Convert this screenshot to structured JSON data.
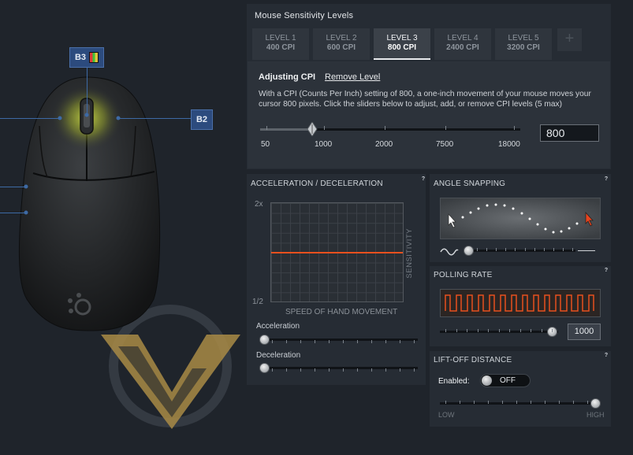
{
  "cpi": {
    "title": "Mouse Sensitivity Levels",
    "levels": [
      {
        "name": "LEVEL 1",
        "cpi": "400 CPI"
      },
      {
        "name": "LEVEL 2",
        "cpi": "600 CPI"
      },
      {
        "name": "LEVEL 3",
        "cpi": "800 CPI"
      },
      {
        "name": "LEVEL 4",
        "cpi": "2400 CPI"
      },
      {
        "name": "LEVEL 5",
        "cpi": "3200 CPI"
      }
    ],
    "active_level": 3,
    "add_label": "+",
    "adjusting_label": "Adjusting CPI",
    "remove_label": "Remove Level",
    "description": "With a CPI (Counts Per Inch) setting of 800, a one-inch movement of your mouse moves your cursor 800 pixels. Click the sliders below to adjust, add, or remove CPI levels (5 max)",
    "scale": [
      "50",
      "1000",
      "2000",
      "7500",
      "18000"
    ],
    "value": "800"
  },
  "accel": {
    "title": "ACCELERATION / DECELERATION",
    "help": "?",
    "y_top": "2x",
    "y_bottom": "1/2",
    "side_label": "SENSITIVITY",
    "x_label": "SPEED OF HAND MOVEMENT",
    "accel_label": "Acceleration",
    "decel_label": "Deceleration",
    "curve_color": "#e8501e"
  },
  "angle": {
    "title": "ANGLE SNAPPING",
    "help": "?"
  },
  "polling": {
    "title": "POLLING RATE",
    "help": "?",
    "value": "1000",
    "wave_color": "#e8501e",
    "level": 1.0
  },
  "liftoff": {
    "title": "LIFT-OFF DISTANCE",
    "help": "?",
    "enabled_label": "Enabled:",
    "toggle_label": "OFF",
    "low_label": "LOW",
    "high_label": "HIGH"
  },
  "mouse": {
    "b3_label": "B3",
    "b2_label": "B2"
  }
}
